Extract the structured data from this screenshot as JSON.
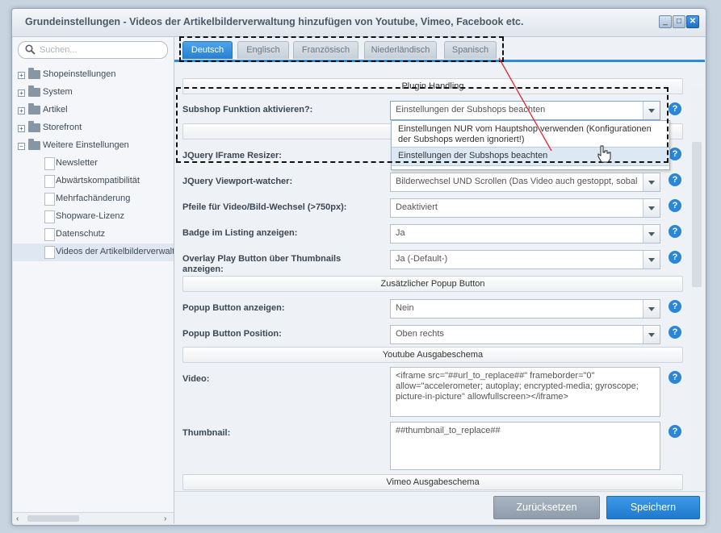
{
  "window": {
    "title": "Grundeinstellungen - Videos der Artikelbilderverwaltung hinzufügen von Youtube, Vimeo, Facebook etc.",
    "minimize": "_",
    "maximize": "□",
    "close": "✕"
  },
  "sidebar": {
    "search_placeholder": "Suchen...",
    "tree": [
      {
        "label": "Shopeinstellungen",
        "type": "folder"
      },
      {
        "label": "System",
        "type": "folder"
      },
      {
        "label": "Artikel",
        "type": "folder"
      },
      {
        "label": "Storefront",
        "type": "folder"
      },
      {
        "label": "Weitere Einstellungen",
        "type": "folder-open"
      },
      {
        "label": "Newsletter",
        "type": "doc"
      },
      {
        "label": "Abwärtskompatibilität",
        "type": "doc"
      },
      {
        "label": "Mehrfachänderung",
        "type": "doc"
      },
      {
        "label": "Shopware-Lizenz",
        "type": "doc"
      },
      {
        "label": "Datenschutz",
        "type": "doc"
      },
      {
        "label": "Videos der Artikelbilderverwaltung",
        "type": "doc",
        "selected": true
      }
    ]
  },
  "tabs": [
    "Deutsch",
    "Englisch",
    "Französisch",
    "Niederländisch",
    "Spanisch"
  ],
  "sections": {
    "plugin_handling": "Plugin Handling",
    "popup": "Zusätzlicher Popup Button",
    "youtube": "Youtube Ausgabeschema",
    "vimeo": "Vimeo Ausgabeschema"
  },
  "fields": {
    "subshop": {
      "label": "Subshop Funktion aktivieren?:",
      "value": "Einstellungen der Subshops beachten"
    },
    "iframe_resizer": {
      "label": "JQuery IFrame Resizer:"
    },
    "viewport": {
      "label": "JQuery Viewport-watcher:",
      "value": "Bilderwechsel UND Scrollen (Das Video auch gestoppt, sobald"
    },
    "arrows": {
      "label": "Pfeile für Video/Bild-Wechsel (>750px):",
      "value": "Deaktiviert"
    },
    "badge": {
      "label": "Badge im Listing anzeigen:",
      "value": "Ja"
    },
    "overlay": {
      "label": "Overlay Play Button über Thumbnails anzeigen:",
      "value": "Ja (-Default-)"
    },
    "popup_show": {
      "label": "Popup Button anzeigen:",
      "value": "Nein"
    },
    "popup_pos": {
      "label": "Popup Button Position:",
      "value": "Oben rechts"
    },
    "video": {
      "label": "Video:",
      "value": "<iframe src=\"##url_to_replace##\" frameborder=\"0\" allow=\"accelerometer; autoplay; encrypted-media; gyroscope; picture-in-picture\" allowfullscreen></iframe>"
    },
    "thumbnail": {
      "label": "Thumbnail:",
      "value": "##thumbnail_to_replace##"
    }
  },
  "dropdown_options": [
    "Einstellungen NUR vom Hauptshop verwenden (Konfigurationen der Subshops werden ignoriert!)",
    "Einstellungen der Subshops beachten"
  ],
  "help_glyph": "?",
  "footer": {
    "reset": "Zurücksetzen",
    "save": "Speichern"
  },
  "colors": {
    "accent": "#2b86d6",
    "annotation": "#e8262a"
  }
}
